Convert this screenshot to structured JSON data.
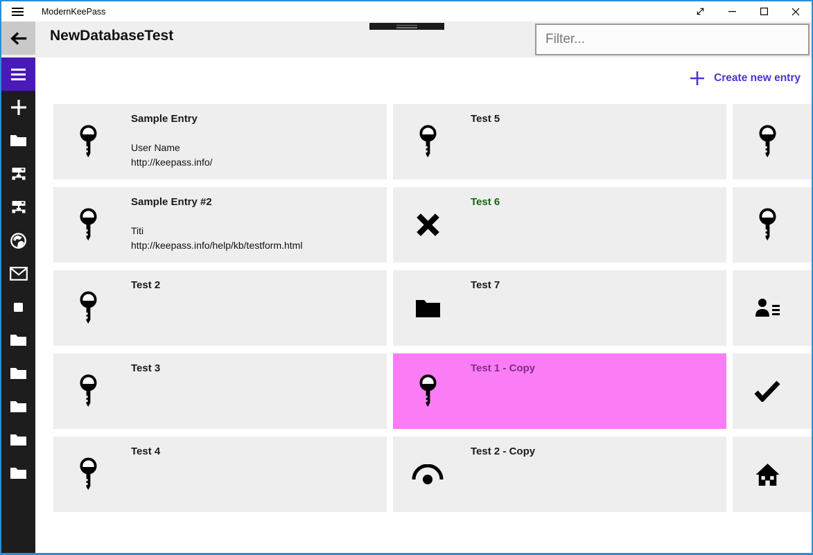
{
  "window": {
    "title": "ModernKeePass",
    "border_color": "#2b8dd9"
  },
  "titlebar": {
    "controls": [
      {
        "name": "fullscreen",
        "icon": "diagonal-resize-icon"
      },
      {
        "name": "minimize",
        "icon": "minimize-icon"
      },
      {
        "name": "maximize",
        "icon": "maximize-icon"
      },
      {
        "name": "close",
        "icon": "close-icon"
      }
    ]
  },
  "header": {
    "back_icon": "back-arrow-icon",
    "page_title": "NewDatabaseTest",
    "filter_placeholder": "Filter..."
  },
  "sidebar": {
    "items": [
      {
        "icon": "hamburger"
      },
      {
        "icon": "plus"
      },
      {
        "icon": "folder"
      },
      {
        "icon": "network"
      },
      {
        "icon": "network"
      },
      {
        "icon": "globe"
      },
      {
        "icon": "mail"
      },
      {
        "icon": "square"
      },
      {
        "icon": "folder"
      },
      {
        "icon": "folder"
      },
      {
        "icon": "folder"
      },
      {
        "icon": "folder"
      },
      {
        "icon": "folder"
      }
    ]
  },
  "main": {
    "create_new_entry_label": "Create new entry",
    "entries": [
      {
        "title": "Sample Entry",
        "icon": "key",
        "lines": [
          "User Name",
          "http://keepass.info/"
        ]
      },
      {
        "title": "Test 5",
        "icon": "key"
      },
      {
        "title": "",
        "icon": "key",
        "clipped": true
      },
      {
        "title": "Sample Entry #2",
        "icon": "key",
        "lines": [
          "Titi",
          "http://keepass.info/help/kb/testform.html"
        ]
      },
      {
        "title": "Test 6",
        "icon": "close-x",
        "fg": "#156415"
      },
      {
        "title": "",
        "icon": "key",
        "clipped": true
      },
      {
        "title": "Test 2",
        "icon": "key"
      },
      {
        "title": "Test 7",
        "icon": "folder-black"
      },
      {
        "title": "",
        "icon": "contact-list",
        "clipped": true
      },
      {
        "title": "Test 3",
        "icon": "key"
      },
      {
        "title": "Test 1 - Copy",
        "icon": "key",
        "bg": "#fa7df5",
        "fg": "#87288c",
        "selected": true
      },
      {
        "title": "",
        "icon": "check",
        "clipped": true
      },
      {
        "title": "Test 4",
        "icon": "key"
      },
      {
        "title": "Test 2 - Copy",
        "icon": "view"
      },
      {
        "title": "",
        "icon": "home",
        "clipped": true
      }
    ]
  },
  "colors": {
    "accent_purple": "#4a1ab8",
    "link_purple": "#5230d6",
    "selected_bg": "#fa7df5",
    "selected_title": "#87288c",
    "green_title": "#156415",
    "card_bg": "#eeeeee",
    "sidebar_bg": "#1d1d1d",
    "window_border": "#2b8dd9"
  }
}
